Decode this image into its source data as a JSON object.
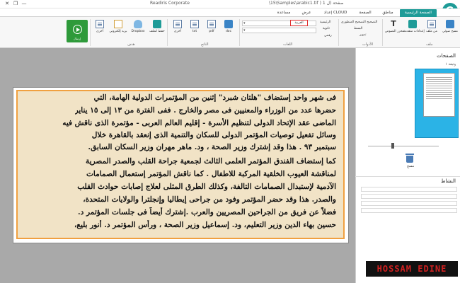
{
  "window": {
    "title": "Readiris Corporate",
    "file_path": "\\15\\Samples\\arabic1.tif ) 1 صفحة (ل",
    "controls": [
      "—",
      "❐",
      "✕"
    ]
  },
  "tabs": [
    {
      "label": "الصفحة الرئيسية",
      "active": true
    },
    {
      "label": "مناطق",
      "active": false
    },
    {
      "label": "الصفحة",
      "active": false
    },
    {
      "label": "إعداد CLOUD",
      "active": false
    },
    {
      "label": "عرض",
      "active": false
    },
    {
      "label": "مساعدة",
      "active": false
    }
  ],
  "ribbon": {
    "scan_group": {
      "label": "ملف",
      "buttons": [
        "مسح ضوئي",
        "من ملف",
        "إعدادات متقدمة",
        "محرر النصوص"
      ]
    },
    "tools_group": {
      "label": "الأدوات",
      "items": [
        "التصحيح التصحيح المنظوري",
        "البسط",
        "تدوير"
      ]
    },
    "languages_group": {
      "label": "اللغات",
      "main_label": "الرئيسية",
      "secondary_label": "ثانوية",
      "numbers_label": "رقمي",
      "main_value": "العربية"
    },
    "output_group": {
      "label": "الناتج",
      "buttons": [
        "doc",
        "pdf",
        "txt",
        "أخرى"
      ]
    },
    "target_group": {
      "label": "هدف",
      "buttons": [
        "حفظ كملف",
        "Dropbox",
        "بريد إلكتروني",
        "أخرى"
      ]
    },
    "send_button": "إرسال"
  },
  "document": {
    "lines": [
      "فى شهر واحد   إستضاف \"هلتان شبرد\" إثنين من المؤتمرات الدولية الهامة، التي",
      "حضرها عدد من الوزراء والمعنيين فى مصر والخارج . ففى الفترة من ١٣ إلى ١٥ يناير",
      "الماضى عقد الإتحاد الدولى لتنظيم الأسرة - إقليم العالم العربى - مؤتمرة الذى ناقش فيه",
      "وسائل تفعيل توصيات المؤتمر الدولى للسكان والتنمية الذى إنعقد بالقاهرة خلال",
      "سبتمبر ٩٣ . هذا وقد إشترك وزير الصحة ، ود. ماهر مهران وزير السكان السابق.",
      "كما إستضاف الفندق المؤتمر العلمى الثالث لجمعية جراحة القلب والصدر المصرية",
      "لمناقشة العيوب الخلقية المركبة للاطفال . كما ناقش المؤتمر إستعمال الصمامات",
      "الآدمية لإستبدال الصمامات التالفة، وكذلك الطرق المثلى لعلاج إصابات حوادث القلب",
      "والصدر. هذا وقد حضر المؤتمر وفود من جراحى إيطاليا وإنجلترا والولايات المتحدة،",
      "فضلاً عن فريق من الجراحين المصريين والعرب .إشترك أيضاً فى جلسات المؤتمر د.",
      "حسين بهاء الدين وزير التعليم، ود. إسماعيل وزير الصحة ، ورأس المؤتمر د. أنور بليع،"
    ]
  },
  "panel": {
    "pages_title": "الصفحات",
    "doc_label": "وثيقة ١",
    "delete_label": "مسح",
    "activity_title": "النشاط"
  },
  "watermark": "HOSSAM EDINE"
}
